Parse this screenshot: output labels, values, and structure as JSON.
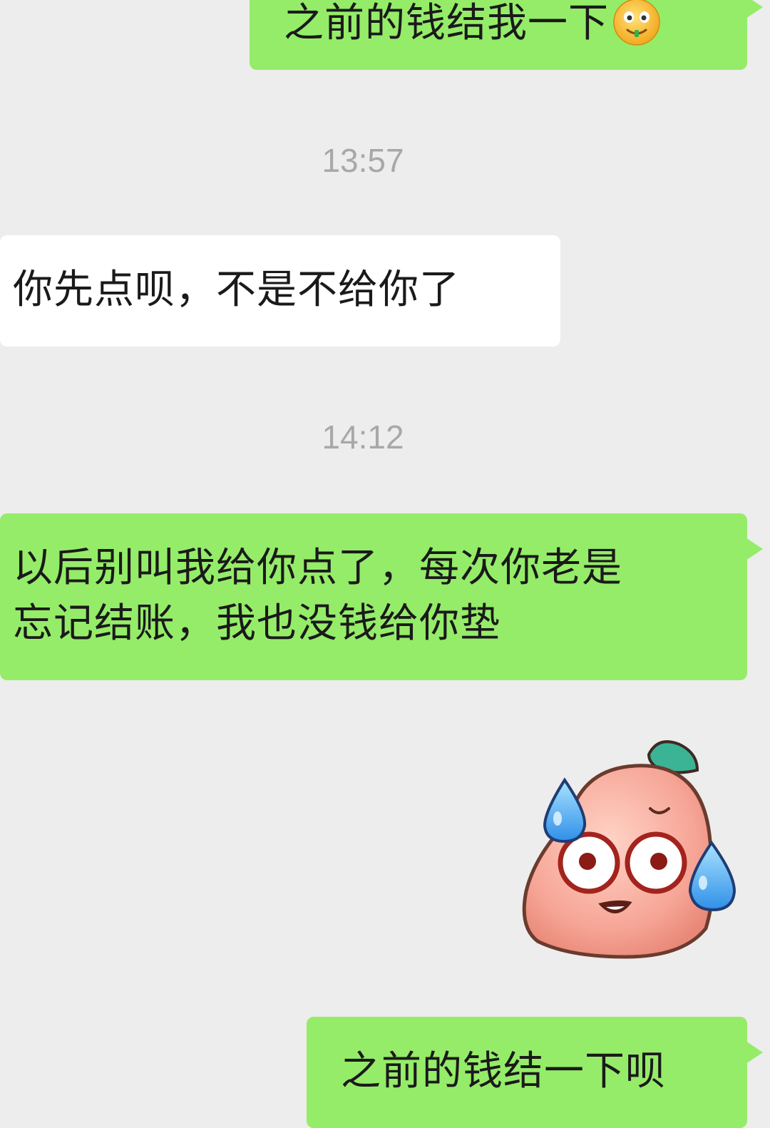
{
  "messages": [
    {
      "type": "sent",
      "text": "之前的钱结我一下",
      "emoji": "smile-emoji-icon"
    },
    {
      "type": "time",
      "text": "13:57"
    },
    {
      "type": "received",
      "text": "你先点呗，不是不给你了"
    },
    {
      "type": "time",
      "text": "14:12"
    },
    {
      "type": "sent",
      "text_line1": "以后别叫我给你点了，每次你老是",
      "text_line2": "忘记结账，我也没钱给你垫"
    },
    {
      "type": "sticker",
      "name": "sweating-peach-sticker"
    },
    {
      "type": "sent",
      "text": "之前的钱结一下呗"
    }
  ],
  "colors": {
    "background": "#ededed",
    "sent_bubble": "#95ec69",
    "received_bubble": "#ffffff",
    "timestamp_text": "#a8a8a8"
  }
}
